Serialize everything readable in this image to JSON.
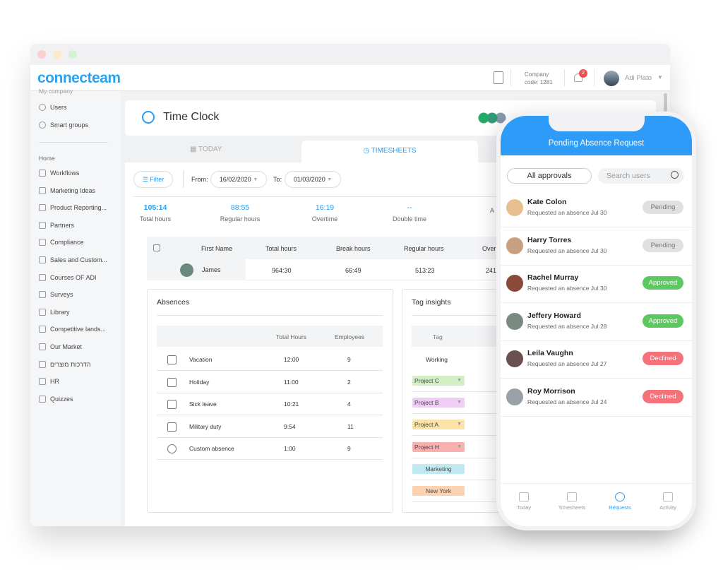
{
  "window": {
    "logo": "connecteam",
    "company_label": "Company",
    "company_code": "code: 1281",
    "notification_count": "2",
    "user_name": "Adi Plato"
  },
  "sidebar": {
    "section_top": "My company",
    "top_items": [
      {
        "label": "Users"
      },
      {
        "label": "Smart groups"
      }
    ],
    "section_home": "Home",
    "items": [
      {
        "label": "Workflows"
      },
      {
        "label": "Marketing Ideas"
      },
      {
        "label": "Product Reporting..."
      },
      {
        "label": "Partners"
      },
      {
        "label": "Compliance"
      },
      {
        "label": "Sales and Custom..."
      },
      {
        "label": "Courses OF ADI"
      },
      {
        "label": "Surveys"
      },
      {
        "label": "Library"
      },
      {
        "label": "Competitive lands..."
      },
      {
        "label": "Our Market"
      },
      {
        "label": "הדרכות מוצרים"
      },
      {
        "label": "HR"
      },
      {
        "label": "Quizzes"
      }
    ]
  },
  "page": {
    "title": "Time Clock",
    "tabs": [
      {
        "label": "TODAY"
      },
      {
        "label": "TIMESHEETS"
      }
    ],
    "filter": "Filter",
    "from_label": "From:",
    "from_value": "16/02/2020",
    "to_label": "To:",
    "to_value": "01/03/2020",
    "stats": [
      {
        "value": "105:14",
        "label": "Total hours"
      },
      {
        "value": "88:55",
        "label": "Regular hours"
      },
      {
        "value": "16:19",
        "label": "Overtime"
      },
      {
        "value": "--",
        "label": "Double time"
      },
      {
        "value": "",
        "label": "A"
      }
    ],
    "table": {
      "headers": [
        "First Name",
        "Total hours",
        "Break hours",
        "Regular hours",
        "Over"
      ],
      "rows": [
        [
          "James",
          "964:30",
          "66:49",
          "513:23",
          "241"
        ]
      ]
    },
    "absences": {
      "title": "Absences",
      "headers": [
        "Total Hours",
        "Employees"
      ],
      "rows": [
        {
          "name": "Vacation",
          "hours": "12:00",
          "employees": "9"
        },
        {
          "name": "Holiday",
          "hours": "11:00",
          "employees": "2"
        },
        {
          "name": "Sick leave",
          "hours": "10:21",
          "employees": "4"
        },
        {
          "name": "Military duty",
          "hours": "9:54",
          "employees": "11"
        },
        {
          "name": "Custom absence",
          "hours": "1:00",
          "employees": "9"
        }
      ]
    },
    "tags": {
      "title": "Tag insights",
      "header": "Tag",
      "first": "Working",
      "items": [
        {
          "label": "Project C",
          "color": "#d4efc4",
          "dropdown": true
        },
        {
          "label": "Project B",
          "color": "#efcdf5",
          "dropdown": true
        },
        {
          "label": "Project A",
          "color": "#fbe3a8",
          "dropdown": true
        },
        {
          "label": "Project H",
          "color": "#fbb0b0",
          "dropdown": true
        },
        {
          "label": "Marketing",
          "color": "#c0eaf2",
          "dropdown": false
        },
        {
          "label": "New York",
          "color": "#fdd2b0",
          "dropdown": false
        }
      ]
    }
  },
  "phone": {
    "title": "Pending Absence Request",
    "filter": "All approvals",
    "search_placeholder": "Search users",
    "requests": [
      {
        "name": "Kate Colon",
        "sub": "Requested an absence Jul 30",
        "status": "Pending",
        "color": "#e0e0e0"
      },
      {
        "name": "Harry Torres",
        "sub": "Requested an absence Jul 30",
        "status": "Pending",
        "color": "#e0e0e0"
      },
      {
        "name": "Rachel Murray",
        "sub": "Requested an absence Jul 30",
        "status": "Approved",
        "color": "#5cc860"
      },
      {
        "name": "Jeffery Howard",
        "sub": "Requested an absence Jul 28",
        "status": "Approved",
        "color": "#5cc860"
      },
      {
        "name": "Leila Vaughn",
        "sub": "Requested an absence Jul 27",
        "status": "Declined",
        "color": "#f4727a"
      },
      {
        "name": "Roy Morrison",
        "sub": "Requested an absence Jul 24",
        "status": "Declined",
        "color": "#f4727a"
      }
    ],
    "nav": [
      {
        "label": "Today"
      },
      {
        "label": "Timesheets"
      },
      {
        "label": "Requests",
        "active": true
      },
      {
        "label": "Activity"
      }
    ]
  },
  "colors": {
    "accent": "#2a9df4",
    "phone_header": "#2d9bf7"
  }
}
